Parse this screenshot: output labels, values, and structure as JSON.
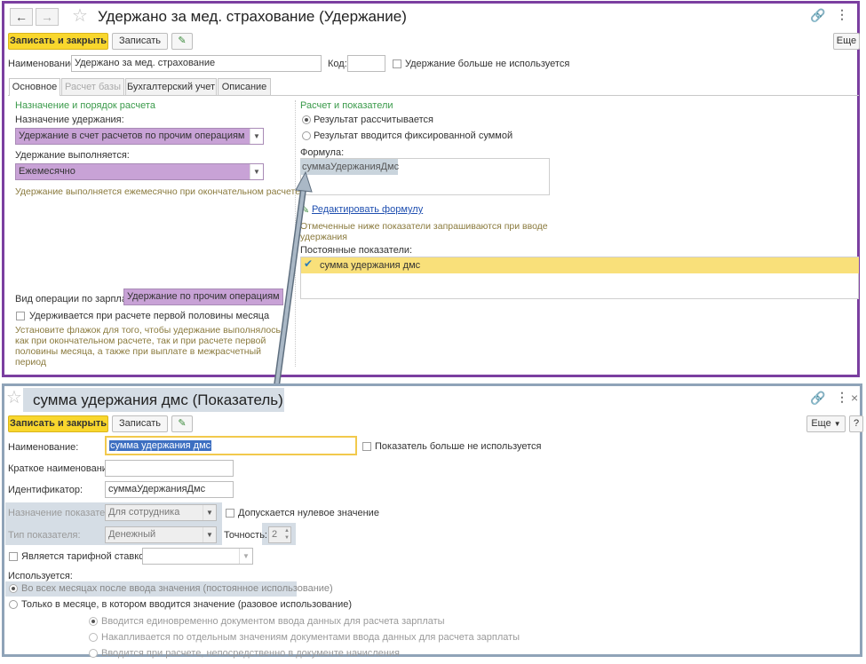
{
  "form1": {
    "title": "Удержано за мед. страхование (Удержание)",
    "save_close": "Записать и закрыть",
    "save": "Записать",
    "more": "Еще",
    "name_label": "Наименование:",
    "name_value": "Удержано за мед. страхование",
    "code_label": "Код:",
    "code_value": "",
    "not_used_label": "Удержание больше не используется",
    "tabs": [
      {
        "label": "Основное"
      },
      {
        "label": "Расчет базы"
      },
      {
        "label": "Бухгалтерский учет"
      },
      {
        "label": "Описание"
      }
    ],
    "left": {
      "section_title": "Назначение и порядок расчета",
      "purpose_label": "Назначение удержания:",
      "purpose_value": "Удержание в счет расчетов по прочим операциям",
      "executed_label": "Удержание выполняется:",
      "executed_value": "Ежемесячно",
      "executed_hint": "Удержание выполняется ежемесячно при окончательном расчете",
      "op_label": "Вид операции по зарплате:",
      "op_value": "Удержание по прочим операциям с раб",
      "first_half_label": "Удерживается при расчете первой половины месяца",
      "first_half_hint_1": "Установите флажок для того, чтобы удержание выполнялось",
      "first_half_hint_2": "как при окончательном расчете, так и при расчете первой",
      "first_half_hint_3": "половины месяца, а также при выплате в межрасчетный",
      "first_half_hint_4": "период"
    },
    "right": {
      "section_title": "Расчет и показатели",
      "radio_calc": "Результат рассчитывается",
      "radio_fixed": "Результат вводится фиксированной суммой",
      "formula_label": "Формула:",
      "formula_value": "суммаУдержанияДмс",
      "edit_formula": "Редактировать формулу",
      "note_1": "Отмеченные ниже показатели запрашиваются при вводе",
      "note_2": "удержания",
      "const_label": "Постоянные показатели:",
      "const_item": "сумма удержания дмс"
    }
  },
  "form2": {
    "title": "сумма удержания дмс (Показатель)",
    "save_close": "Записать и закрыть",
    "save": "Записать",
    "more": "Еще",
    "help": "?",
    "name_label": "Наименование:",
    "name_value": "сумма удержания дмс",
    "not_used_label": "Показатель больше не используется",
    "short_label": "Краткое наименование:",
    "short_value": "",
    "id_label": "Идентификатор:",
    "id_value": "суммаУдержанияДмс",
    "purpose_label": "Назначение показателя:",
    "purpose_value": "Для сотрудника",
    "zero_label": "Допускается нулевое значение",
    "type_label": "Тип показателя:",
    "type_value": "Денежный",
    "precision_label": "Точность:",
    "precision_value": "2",
    "tariff_label": "Является тарифной ставкой",
    "used_label": "Используется:",
    "opt_all": "Во всех месяцах после ввода значения (постоянное использование)",
    "opt_month": "Только в месяце, в котором вводится значение (разовое использование)",
    "sub_1": "Вводится единовременно документом ввода данных для расчета зарплаты",
    "sub_2": "Накапливается по отдельным значениям документами ввода данных для расчета зарплаты",
    "sub_3": "Вводится при расчете, непосредственно в документе начисления"
  },
  "icons": {
    "back": "arrow-left-icon",
    "forward": "arrow-right-icon",
    "favorite": "star-icon",
    "link": "link-icon",
    "menu": "kebab-menu-icon",
    "close": "close-icon",
    "edit": "pencil-icon",
    "check": "checkmark-icon"
  },
  "colors": {
    "primary_button": "#f9d72d",
    "highlight_field": "#c8a2d6",
    "frame1": "#7b3fa0",
    "frame2": "#8fa3b8",
    "section_title": "#3a9a4a",
    "selected_row": "#f9e07a"
  }
}
